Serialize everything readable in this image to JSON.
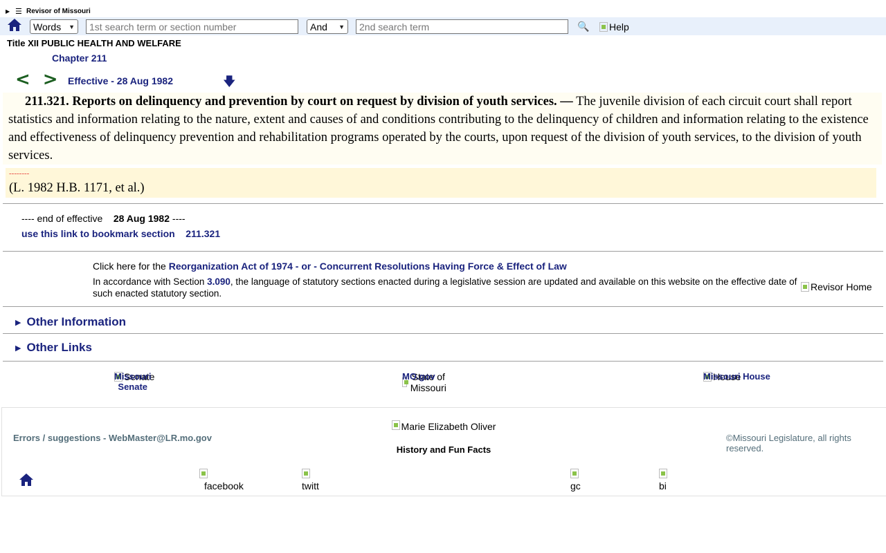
{
  "topbar": {
    "site_name": "Revisor of Missouri"
  },
  "search": {
    "mode_value": "Words",
    "term1_placeholder": "1st search term or section number",
    "op_value": "And",
    "term2_placeholder": "2nd search term",
    "help_label": "Help"
  },
  "breadcrumb": {
    "title": "Title XII PUBLIC HEALTH AND WELFARE",
    "chapter": "Chapter 211"
  },
  "nav": {
    "prev": "<",
    "next": ">",
    "effective": "Effective - 28 Aug 1982"
  },
  "section": {
    "heading": "211.321.  Reports on delinquency and prevention by court on request by division of youth services. —",
    "body": " The juvenile division of each circuit court shall report statistics and information relating to the nature, extent and causes of and conditions contributing to the delinquency of children and information relating to the existence and effectiveness of delinquency prevention and rehabilitation programs operated by the courts, upon request of the division of youth services, to the division of youth services.",
    "separator": "--------",
    "history": "(L. 1982 H.B. 1171, et al.)"
  },
  "end": {
    "prefix": "---- end of effective",
    "date": "28 Aug 1982",
    "suffix": "----",
    "bookmark_label": "use this link to bookmark section",
    "bookmark_section": "211.321"
  },
  "notice": {
    "reorg_prefix": "Click here for the ",
    "reorg_link": "Reorganization Act of 1974 - or - Concurrent Resolutions Having Force & Effect of Law",
    "accord_prefix": "In accordance with Section ",
    "accord_link": "3.090",
    "accord_suffix": ", the language of statutory sections enacted during a legislative session are updated and available on this website on the effective date of such enacted statutory section.",
    "revisor_home": "Revisor Home"
  },
  "sections": {
    "other_info": "Other Information",
    "other_links": "Other Links"
  },
  "footer": {
    "senate_alt": "Senate",
    "senate_label": "Missouri Senate",
    "state_alt": "State of Missouri",
    "state_label": "MO.gov",
    "house_alt": "House",
    "house_label": "Missouri House",
    "errors": "Errors / suggestions - WebMaster@LR.mo.gov",
    "marie": "Marie Elizabeth Oliver",
    "history_fun": "History and Fun Facts",
    "copyright": "©Missouri Legislature, all rights reserved.",
    "facebook": "facebook",
    "twitter": "twitt",
    "google": "gc",
    "bing": "bi"
  },
  "colors": {
    "navy": "#1a237e",
    "green_arrows": "#1b5e20",
    "search_bar_bg": "#e8f0fb",
    "section_bg": "#fffdf2",
    "history_bg": "#fff7d9"
  }
}
